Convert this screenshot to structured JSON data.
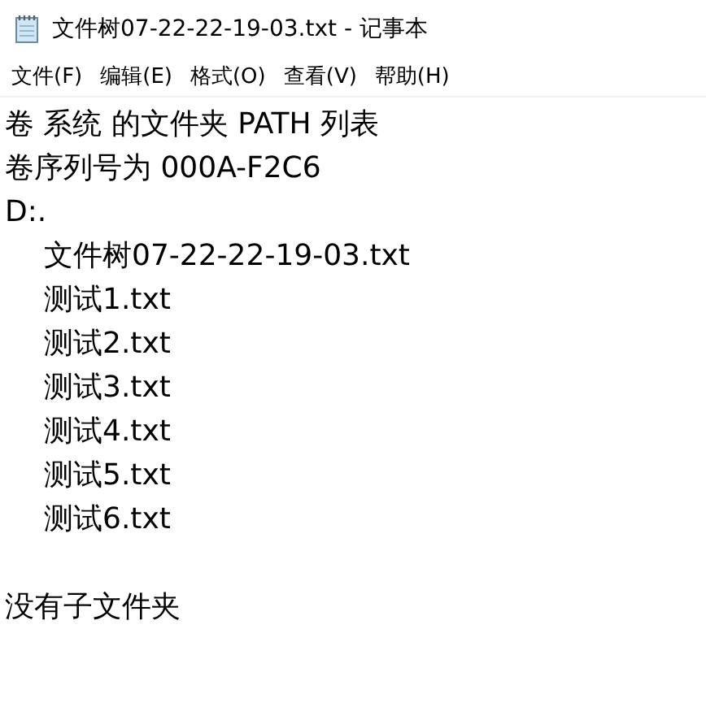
{
  "window": {
    "title": "文件树07-22-22-19-03.txt - 记事本"
  },
  "menu": [
    "文件(F)",
    "编辑(E)",
    "格式(O)",
    "查看(V)",
    "帮助(H)"
  ],
  "document": {
    "header": [
      "卷 系统 的文件夹 PATH 列表",
      "卷序列号为 000A-F2C6"
    ],
    "folder": {
      "text": "D:.",
      "children": [
        {
          "text": "文件树07-22-22-19-03.txt"
        },
        {
          "text": "测试1.txt"
        },
        {
          "text": "测试2.txt"
        },
        {
          "text": "测试3.txt"
        },
        {
          "text": "测试4.txt"
        },
        {
          "text": "测试5.txt"
        },
        {
          "text": "测试6.txt"
        }
      ]
    },
    "footer": "没有子文件夹"
  }
}
